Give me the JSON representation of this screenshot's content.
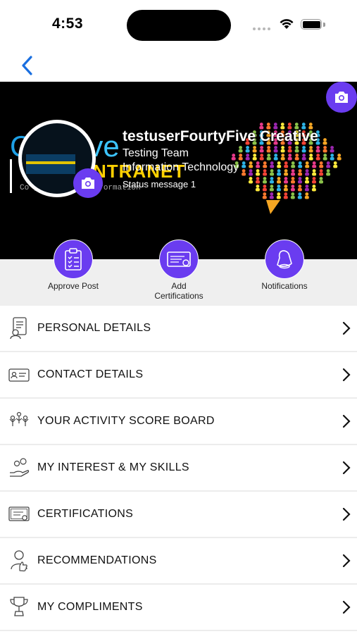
{
  "status_bar": {
    "time": "4:53"
  },
  "profile": {
    "name": "testuserFourtyFive Creative",
    "team": "Testing Team",
    "department": "Information Technology",
    "status_message": "Status message 1"
  },
  "banner_art": {
    "logo_left": "C",
    "logo_right": "ive",
    "intranet": "NTRANET",
    "tagline": "Co           , Process & Information"
  },
  "actions": [
    {
      "label": "Approve Post",
      "icon": "clipboard-icon"
    },
    {
      "label": "Add\nCertifications",
      "icon": "certificate-icon"
    },
    {
      "label": "Notifications",
      "icon": "bell-icon"
    }
  ],
  "menu": [
    {
      "label": "PERSONAL DETAILS",
      "icon": "person-document-icon"
    },
    {
      "label": "CONTACT DETAILS",
      "icon": "contact-card-icon"
    },
    {
      "label": "YOUR ACTIVITY SCORE BOARD",
      "icon": "team-celebrate-icon"
    },
    {
      "label": "MY INTEREST & MY SKILLS",
      "icon": "hand-people-icon"
    },
    {
      "label": "CERTIFICATIONS",
      "icon": "certificate-icon"
    },
    {
      "label": "RECOMMENDATIONS",
      "icon": "thumbs-up-person-icon"
    },
    {
      "label": "MY COMPLIMENTS",
      "icon": "trophy-icon"
    }
  ],
  "colors": {
    "accent": "#6a3cf0",
    "back": "#1a6fe0",
    "strip": "#efefef"
  }
}
